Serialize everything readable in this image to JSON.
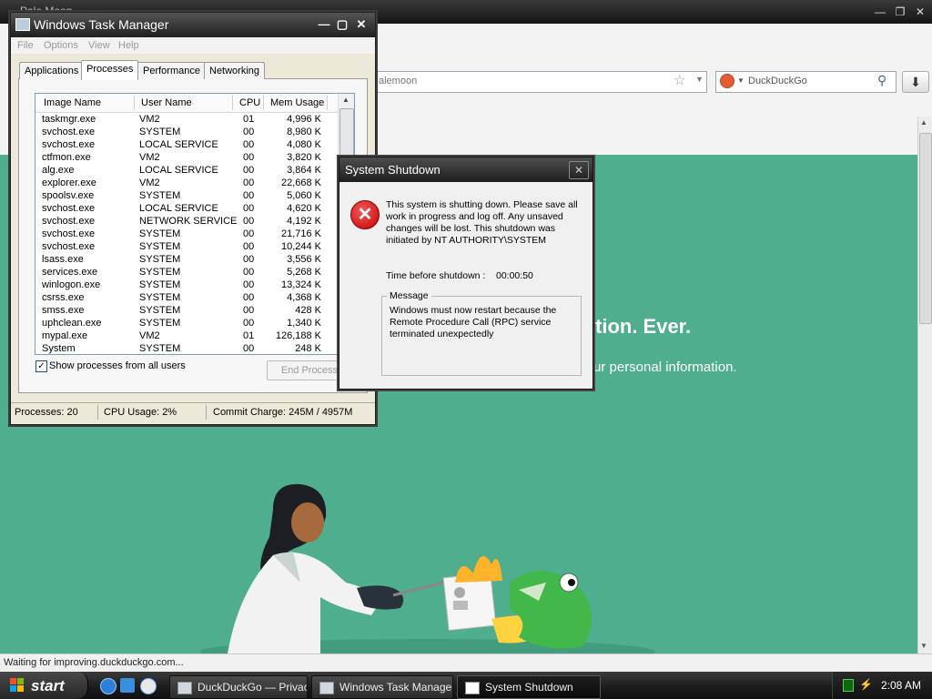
{
  "browser": {
    "title": "Pale Moon",
    "url_text": "alemoon",
    "search_placeholder": "DuckDuckGo",
    "status_text": "Waiting for improving.duckduckgo.com..."
  },
  "page": {
    "headline": "tion. Ever.",
    "subtext": "ur personal information."
  },
  "task_manager": {
    "title": "Windows Task Manager",
    "menu": [
      "File",
      "Options",
      "View",
      "Help"
    ],
    "tabs": [
      "Applications",
      "Processes",
      "Performance",
      "Networking"
    ],
    "active_tab": "Processes",
    "columns": [
      "Image Name",
      "User Name",
      "CPU",
      "Mem Usage"
    ],
    "processes": [
      [
        "taskmgr.exe",
        "VM2",
        "01",
        "4,996 K"
      ],
      [
        "svchost.exe",
        "SYSTEM",
        "00",
        "8,980 K"
      ],
      [
        "svchost.exe",
        "LOCAL SERVICE",
        "00",
        "4,080 K"
      ],
      [
        "ctfmon.exe",
        "VM2",
        "00",
        "3,820 K"
      ],
      [
        "alg.exe",
        "LOCAL SERVICE",
        "00",
        "3,864 K"
      ],
      [
        "explorer.exe",
        "VM2",
        "00",
        "22,668 K"
      ],
      [
        "spoolsv.exe",
        "SYSTEM",
        "00",
        "5,060 K"
      ],
      [
        "svchost.exe",
        "LOCAL SERVICE",
        "00",
        "4,620 K"
      ],
      [
        "svchost.exe",
        "NETWORK SERVICE",
        "00",
        "4,192 K"
      ],
      [
        "svchost.exe",
        "SYSTEM",
        "00",
        "21,716 K"
      ],
      [
        "svchost.exe",
        "SYSTEM",
        "00",
        "10,244 K"
      ],
      [
        "lsass.exe",
        "SYSTEM",
        "00",
        "3,556 K"
      ],
      [
        "services.exe",
        "SYSTEM",
        "00",
        "5,268 K"
      ],
      [
        "winlogon.exe",
        "SYSTEM",
        "00",
        "13,324 K"
      ],
      [
        "csrss.exe",
        "SYSTEM",
        "00",
        "4,368 K"
      ],
      [
        "smss.exe",
        "SYSTEM",
        "00",
        "428 K"
      ],
      [
        "uphclean.exe",
        "SYSTEM",
        "00",
        "1,340 K"
      ],
      [
        "mypal.exe",
        "VM2",
        "01",
        "126,188 K"
      ],
      [
        "System",
        "SYSTEM",
        "00",
        "248 K"
      ]
    ],
    "show_all_label": "Show processes from all users",
    "show_all_checked": true,
    "end_process_label": "End Process",
    "status": {
      "processes": "Processes: 20",
      "cpu": "CPU Usage: 2%",
      "commit": "Commit Charge: 245M / 4957M"
    }
  },
  "shutdown_dialog": {
    "title": "System Shutdown",
    "message": "This system is shutting down. Please save all work in progress and log off. Any unsaved changes will be lost. This shutdown was initiated by NT AUTHORITY\\SYSTEM",
    "time_label": "Time before shutdown :",
    "time_value": "00:00:50",
    "group_label": "Message",
    "group_message": "Windows must now restart because the Remote Procedure Call (RPC) service terminated unexpectedly"
  },
  "taskbar": {
    "start_label": "start",
    "buttons": [
      {
        "label": "DuckDuckGo — Privac...",
        "active": false
      },
      {
        "label": "Windows Task Manager",
        "active": false
      },
      {
        "label": "System Shutdown",
        "active": true
      }
    ],
    "clock": "2:08 AM"
  },
  "colors": {
    "page_background": "#4fae8d",
    "error_red": "#cc0000"
  }
}
